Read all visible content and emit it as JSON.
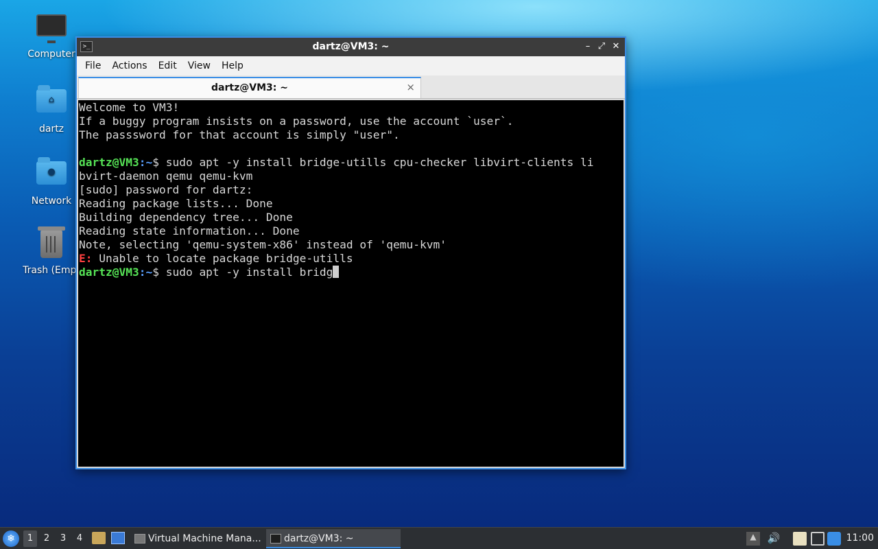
{
  "desktop": {
    "icons": [
      {
        "label": "Computer",
        "icon": "computer-icon"
      },
      {
        "label": "dartz",
        "icon": "home-folder-icon"
      },
      {
        "label": "Network",
        "icon": "network-folder-icon"
      },
      {
        "label": "Trash (Empt",
        "icon": "trash-icon"
      }
    ]
  },
  "window": {
    "title": "dartz@VM3: ~",
    "menu": [
      "File",
      "Actions",
      "Edit",
      "View",
      "Help"
    ],
    "tab_label": "dartz@VM3: ~",
    "tab_close": "×"
  },
  "terminal": {
    "lines": [
      "Welcome to VM3!",
      "If a buggy program insists on a password, use the account `user`.",
      "The passsword for that account is simply \"user\".",
      "",
      {
        "user": "dartz@VM3",
        "path": ":~",
        "cmd": "$ sudo apt -y install bridge-utills cpu-checker libvirt-clients li"
      },
      "bvirt-daemon qemu qemu-kvm",
      "[sudo] password for dartz:",
      "Reading package lists... Done",
      "Building dependency tree... Done",
      "Reading state information... Done",
      "Note, selecting 'qemu-system-x86' instead of 'qemu-kvm'",
      {
        "err": "E:",
        "msg": " Unable to locate package bridge-utills"
      },
      {
        "user": "dartz@VM3",
        "path": ":~",
        "cmd": "$ sudo apt -y install bridg",
        "cursor": true
      }
    ]
  },
  "taskbar": {
    "workspaces": [
      "1",
      "2",
      "3",
      "4"
    ],
    "active_workspace": "1",
    "tasks": [
      {
        "label": "Virtual Machine Mana...",
        "icon": "vm-manager-icon",
        "active": false
      },
      {
        "label": "dartz@VM3: ~",
        "icon": "terminal-icon",
        "active": true
      }
    ],
    "clock": "11:00"
  },
  "colors": {
    "prompt_user": "#56e356",
    "prompt_path": "#5aa0ff",
    "error": "#ff4040",
    "accent": "#3a8ee6"
  }
}
